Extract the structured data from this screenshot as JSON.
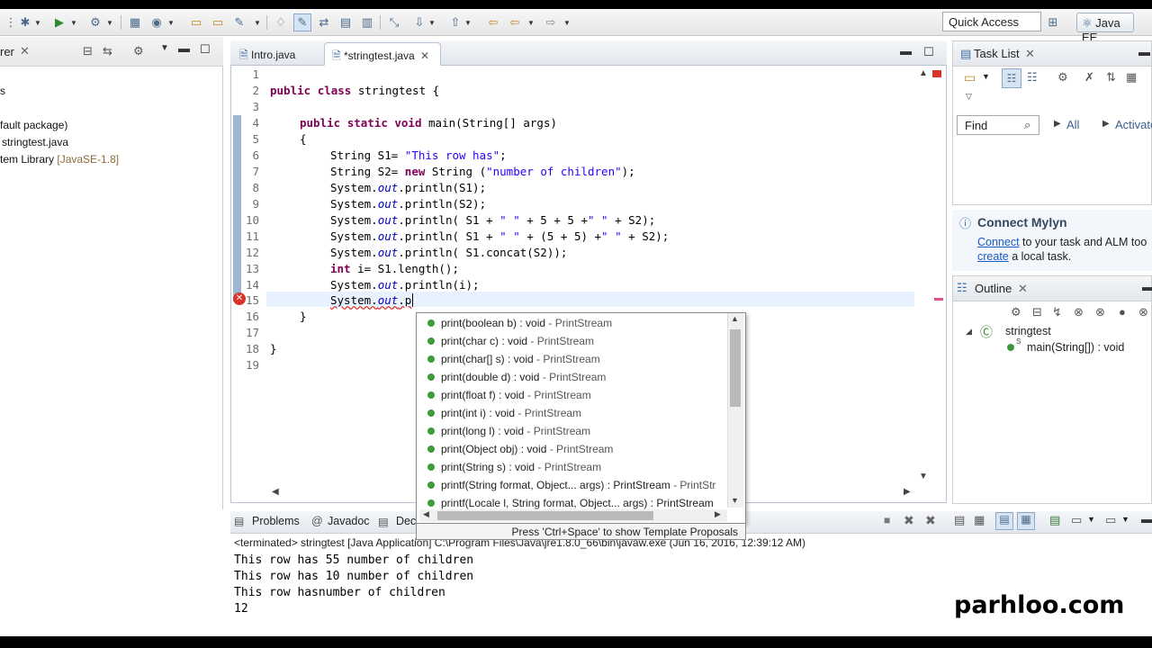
{
  "toolbar": {
    "quick_access": "Quick Access",
    "perspective": "Java EE"
  },
  "left_panel": {
    "tab_fragment": "rer",
    "items": [
      {
        "text": "s"
      },
      {
        "text": "fault package)"
      },
      {
        "text": "stringtest.java"
      },
      {
        "text": "tem Library",
        "suffix": "[JavaSE-1.8]"
      }
    ]
  },
  "editor": {
    "tabs": [
      {
        "label": "Intro.java"
      },
      {
        "label": "*stringtest.java"
      }
    ],
    "line_numbers": [
      "1",
      "2",
      "3",
      "4",
      "5",
      "6",
      "7",
      "8",
      "9",
      "10",
      "11",
      "12",
      "13",
      "14",
      "15",
      "16",
      "17",
      "18",
      "19"
    ],
    "code": {
      "l2_kw1": "public",
      "l2_kw2": "class",
      "l2_rest": " stringtest {",
      "l4_kw1": "public",
      "l4_kw2": "static",
      "l4_kw3": "void",
      "l4_rest": " main(String[] args)",
      "l5": "{",
      "l6_a": "String S1= ",
      "l6_str": "\"This row has\"",
      "l6_b": ";",
      "l7_a": "String S2= ",
      "l7_kw": "new",
      "l7_b": " String (",
      "l7_str": "\"number of children\"",
      "l7_c": ");",
      "l8_a": "System.",
      "l8_fld": "out",
      "l8_b": ".println(S1);",
      "l9_a": "System.",
      "l9_fld": "out",
      "l9_b": ".println(S2);",
      "l10_a": "System.",
      "l10_fld": "out",
      "l10_b": ".println( S1 + ",
      "l10_s1": "\" \"",
      "l10_c": " + 5 + 5 +",
      "l10_s2": "\" \"",
      "l10_d": " + S2);",
      "l11_a": "System.",
      "l11_fld": "out",
      "l11_b": ".println( S1 + ",
      "l11_s1": "\" \"",
      "l11_c": " + (5 + 5) +",
      "l11_s2": "\" \"",
      "l11_d": " + S2);",
      "l12_a": "System.",
      "l12_fld": "out",
      "l12_b": ".println( S1.concat(S2));",
      "l13_kw": "int",
      "l13_b": " i= S1.length();",
      "l14_a": "System.",
      "l14_fld": "out",
      "l14_b": ".println(i);",
      "l15_a": "System.",
      "l15_fld": "out",
      "l15_b": ".p",
      "l16": "}",
      "l18": "}"
    }
  },
  "assist": {
    "items": [
      {
        "sig": "print(boolean b) : void",
        "src": " - PrintStream"
      },
      {
        "sig": "print(char c) : void",
        "src": " - PrintStream"
      },
      {
        "sig": "print(char[] s) : void",
        "src": " - PrintStream"
      },
      {
        "sig": "print(double d) : void",
        "src": " - PrintStream"
      },
      {
        "sig": "print(float f) : void",
        "src": " - PrintStream"
      },
      {
        "sig": "print(int i) : void",
        "src": " - PrintStream"
      },
      {
        "sig": "print(long l) : void",
        "src": " - PrintStream"
      },
      {
        "sig": "print(Object obj) : void",
        "src": " - PrintStream"
      },
      {
        "sig": "print(String s) : void",
        "src": " - PrintStream"
      },
      {
        "sig": "printf(String format, Object... args) : PrintStream",
        "src": " - PrintStr"
      },
      {
        "sig": "printf(Locale l, String format, Object... args) : PrintStream",
        "src": ""
      }
    ],
    "status": "Press 'Ctrl+Space' to show Template Proposals"
  },
  "tasklist": {
    "title": "Task List",
    "find_placeholder": "Find",
    "all": "All",
    "activate": "Activate..."
  },
  "mylyn": {
    "title": "Connect Mylyn",
    "connect_link": "Connect",
    "line1_rest": " to your task and ALM too",
    "create_link": "create",
    "line2_rest": " a local task."
  },
  "outline": {
    "title": "Outline",
    "class_name": "stringtest",
    "method": "main(String[]) : void"
  },
  "console": {
    "tabs": [
      {
        "label": "Problems"
      },
      {
        "label": "Javadoc"
      },
      {
        "label": "Dec"
      }
    ],
    "terminated": "<terminated> stringtest [Java Application] C:\\Program Files\\Java\\jre1.8.0_66\\bin\\javaw.exe (Jun 16, 2016, 12:39:12 AM)",
    "output": [
      "This row has 55 number of children",
      "This row has 10 number of children",
      "This row hasnumber of children",
      "12"
    ]
  },
  "watermark": "parhloo.com"
}
